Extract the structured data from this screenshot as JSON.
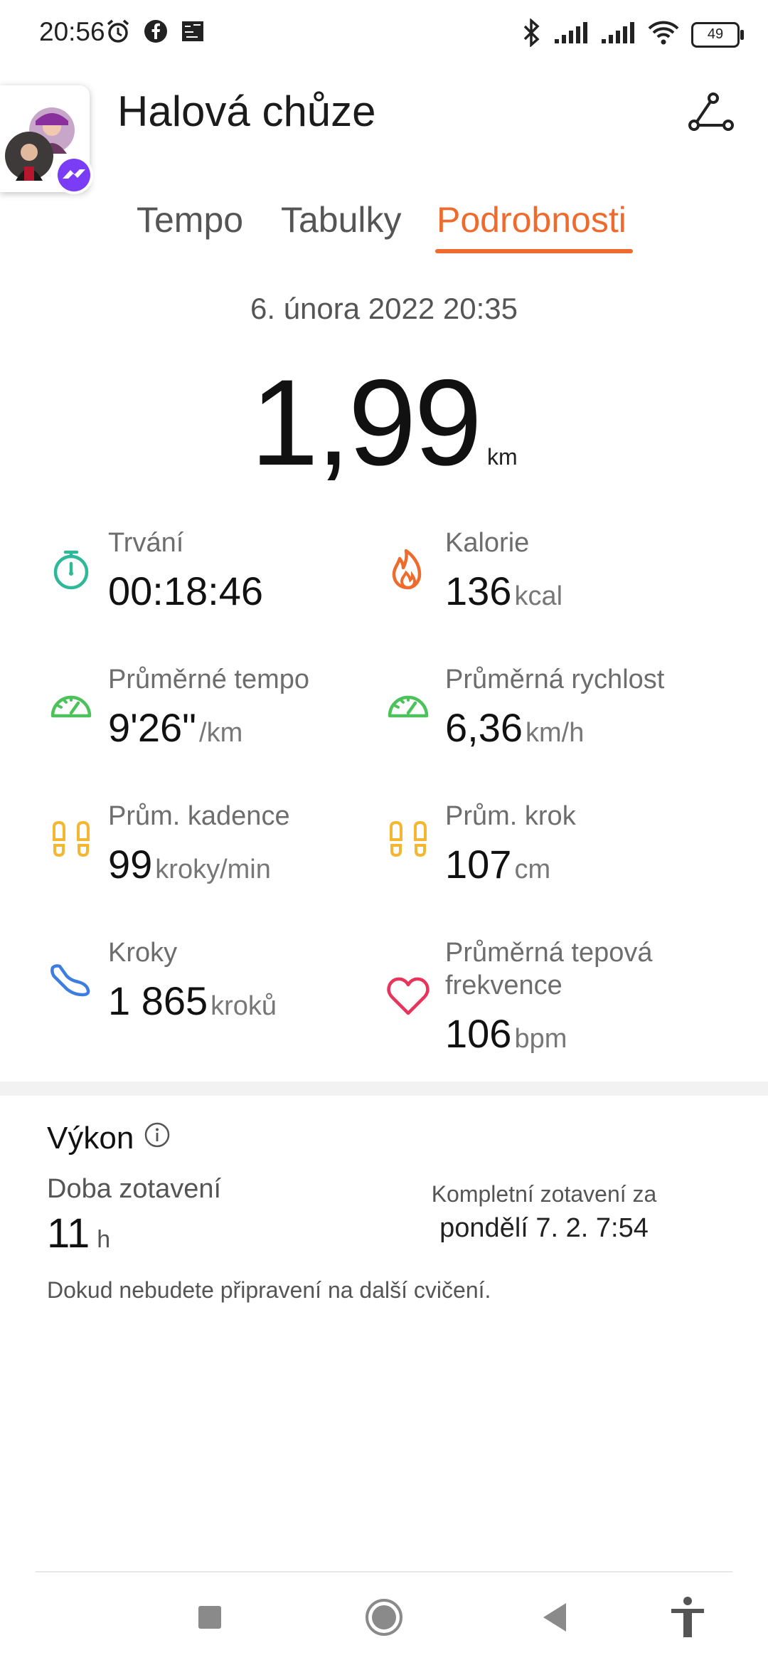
{
  "status_bar": {
    "time": "20:56",
    "battery": "49",
    "icons_left": [
      "alarm-icon",
      "facebook-icon",
      "app-icon"
    ],
    "icons_right": [
      "bluetooth-icon",
      "signal-icon",
      "signal-icon",
      "wifi-icon",
      "battery-icon"
    ]
  },
  "header": {
    "title": "Halová chůze",
    "route_icon": "route-icon"
  },
  "tabs": [
    {
      "label": "Tempo"
    },
    {
      "label": "Tabulky"
    },
    {
      "label": "Podrobnosti"
    }
  ],
  "active_tab": "Podrobnosti",
  "summary": {
    "date": "6. února 2022 20:35",
    "distance": "1,99",
    "distance_unit": "km"
  },
  "stats": [
    {
      "label": "Trvání",
      "value": "00:18:46",
      "unit": "",
      "icon": "stopwatch-icon",
      "color": "#2db89a"
    },
    {
      "label": "Kalorie",
      "value": "136",
      "unit": "kcal",
      "icon": "flame-icon",
      "color": "#ef6b2d"
    },
    {
      "label": "Průměrné tempo",
      "value": "9'26\"",
      "unit": "/km",
      "icon": "speedometer-icon",
      "color": "#4cc25a"
    },
    {
      "label": "Průměrná rychlost",
      "value": "6,36",
      "unit": "km/h",
      "icon": "speedometer-icon",
      "color": "#4cc25a"
    },
    {
      "label": "Prům. kadence",
      "value": "99",
      "unit": "kroky/min",
      "icon": "footprints-icon",
      "color": "#f5b731"
    },
    {
      "label": "Prům. krok",
      "value": "107",
      "unit": "cm",
      "icon": "footprints-icon",
      "color": "#f5b731"
    },
    {
      "label": "Kroky",
      "value": "1 865",
      "unit": "kroků",
      "icon": "shoe-icon",
      "color": "#3d7de0"
    },
    {
      "label": "Průměrná tepová\nfrekvence",
      "label_line1": "Průměrná tepová",
      "label_line2": "frekvence",
      "value": "106",
      "unit": "bpm",
      "icon": "heart-icon",
      "color": "#e8335a"
    }
  ],
  "performance": {
    "title": "Výkon",
    "recovery_label": "Doba zotavení",
    "recovery_value": "11",
    "recovery_unit": "h",
    "complete_label": "Kompletní zotavení za",
    "complete_date": "pondělí 7. 2. 7:54",
    "note": "Dokud nebudete připravení na další cvičení."
  },
  "navbar": {
    "icons": [
      "recents-icon",
      "home-icon",
      "back-icon",
      "accessibility-icon"
    ]
  },
  "colors": {
    "accent": "#ef6b2d"
  }
}
